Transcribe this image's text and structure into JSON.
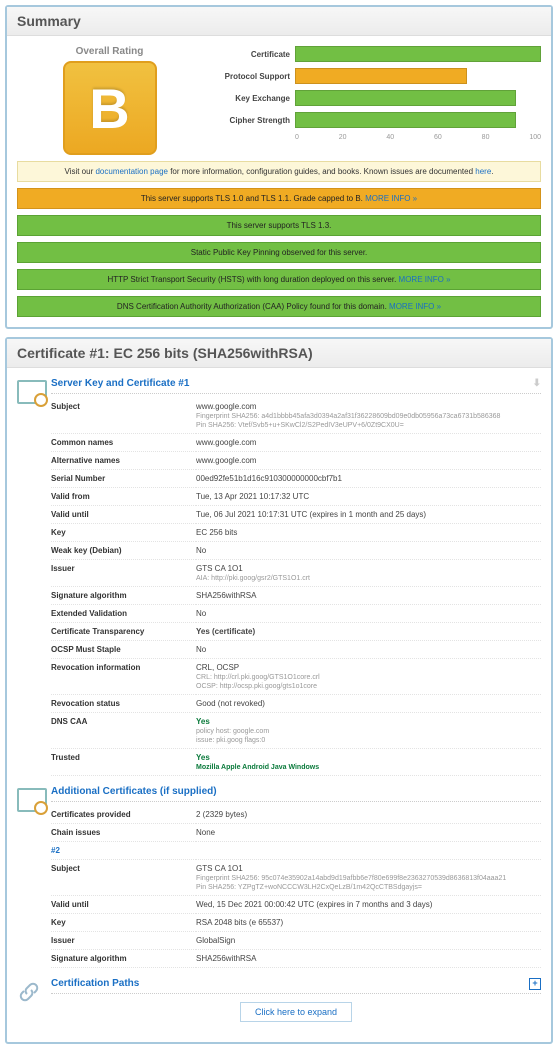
{
  "summary": {
    "title": "Summary",
    "overall_label": "Overall Rating",
    "grade": "B"
  },
  "chart_data": {
    "type": "bar",
    "categories": [
      "Certificate",
      "Protocol Support",
      "Key Exchange",
      "Cipher Strength"
    ],
    "values": [
      100,
      70,
      90,
      90
    ],
    "colors": [
      "green",
      "orange",
      "green",
      "green"
    ],
    "xlim": [
      0,
      100
    ],
    "ticks": [
      0,
      20,
      40,
      60,
      80,
      100
    ]
  },
  "notices": {
    "doc_prefix": "Visit our ",
    "doc_link": "documentation page",
    "doc_mid": " for more information, configuration guides, and books. Known issues are documented ",
    "doc_here": "here",
    "doc_suffix": ".",
    "n1_text": "This server supports TLS 1.0 and TLS 1.1. Grade capped to B. ",
    "n2_text": "This server supports TLS 1.3.",
    "n3_text": "Static Public Key Pinning observed for this server.",
    "n4_text": "HTTP Strict Transport Security (HSTS) with long duration deployed on this server.  ",
    "n5_text": "DNS Certification Authority Authorization (CAA) Policy found for this domain.  ",
    "more_info": "MORE INFO »"
  },
  "cert_panel_title": "Certificate #1: EC 256 bits (SHA256withRSA)",
  "cert1": {
    "section_title": "Server Key and Certificate #1",
    "rows": {
      "subject_k": "Subject",
      "subject_v": "www.google.com",
      "subject_fp": "Fingerprint SHA256: a4d1bbbb45afa3d0394a2af31f36228609bd09e0db05956a73ca6731b586368",
      "subject_pin": "Pin SHA256: Vtef/Svb5+u+SKwCl2/S2PedIV3eUPV+6/0Zt9CX0U=",
      "cn_k": "Common names",
      "cn_v": "www.google.com",
      "an_k": "Alternative names",
      "an_v": "www.google.com",
      "sn_k": "Serial Number",
      "sn_v": "00ed92fe51b1d16c910300000000cbf7b1",
      "vf_k": "Valid from",
      "vf_v": "Tue, 13 Apr 2021 10:17:32 UTC",
      "vu_k": "Valid until",
      "vu_v": "Tue, 06 Jul 2021 10:17:31 UTC (expires in 1 month and 25 days)",
      "key_k": "Key",
      "key_v": "EC 256 bits",
      "wk_k": "Weak key (Debian)",
      "wk_v": "No",
      "iss_k": "Issuer",
      "iss_v": "GTS CA 1O1",
      "iss_aia": "AIA: http://pki.goog/gsr2/GTS1O1.crt",
      "sa_k": "Signature algorithm",
      "sa_v": "SHA256withRSA",
      "ev_k": "Extended Validation",
      "ev_v": "No",
      "ct_k": "Certificate Transparency",
      "ct_v": "Yes (certificate)",
      "oms_k": "OCSP Must Staple",
      "oms_v": "No",
      "ri_k": "Revocation information",
      "ri_v": "CRL, OCSP",
      "ri_crl": "CRL: http://crl.pki.goog/GTS1O1core.crl",
      "ri_ocsp": "OCSP: http://ocsp.pki.goog/gts1o1core",
      "rs_k": "Revocation status",
      "rs_v": "Good (not revoked)",
      "caa_k": "DNS CAA",
      "caa_v": "Yes",
      "caa_host": "policy host: google.com",
      "caa_issue": "issue: pki.goog flags:0",
      "tr_k": "Trusted",
      "tr_v": "Yes",
      "tr_list": "Mozilla  Apple  Android  Java  Windows"
    }
  },
  "addl": {
    "section_title": "Additional Certificates (if supplied)",
    "cp_k": "Certificates provided",
    "cp_v": "2 (2329 bytes)",
    "ci_k": "Chain issues",
    "ci_v": "None",
    "num2": "#2",
    "subject_k": "Subject",
    "subject_v": "GTS CA 1O1",
    "subject_fp": "Fingerprint SHA256: 95c074e35902a14abd9d19afbb6e7f80e699f8e2363270539d8636813f04aaa21",
    "subject_pin": "Pin SHA256: YZPgTZ+woNCCCW3LH2CxQeLzB/1m42QcCTBSdgayjs=",
    "vu_k": "Valid until",
    "vu_v": "Wed, 15 Dec 2021 00:00:42 UTC (expires in 7 months and 3 days)",
    "key_k": "Key",
    "key_v": "RSA 2048 bits (e 65537)",
    "iss_k": "Issuer",
    "iss_v": "GlobalSign",
    "sa_k": "Signature algorithm",
    "sa_v": "SHA256withRSA"
  },
  "paths": {
    "section_title": "Certification Paths",
    "expand": "Click here to expand"
  }
}
